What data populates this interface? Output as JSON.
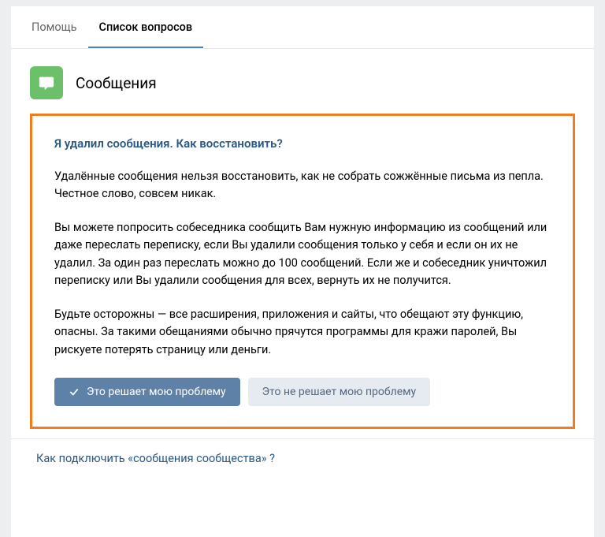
{
  "tabs": {
    "help": "Помощь",
    "questions_list": "Список вопросов"
  },
  "section": {
    "title": "Сообщения"
  },
  "question": {
    "title": "Я удалил сообщения. Как восстановить?",
    "p1": "Удалённые сообщения нельзя восстановить, как не собрать сожжённые письма из пепла. Честное слово, совсем никак.",
    "p2": "Вы можете попросить собеседника сообщить Вам нужную информацию из сообщений или даже переслать переписку, если Вы удалили сообщения только у себя и если он их не удалил. За один раз переслать можно до 100 сообщений. Если же и собеседник уничтожил переписку или Вы удалили сообщения для всех, вернуть их не получится.",
    "p3": "Будьте осторожны — все расширения, приложения и сайты, что обещают эту функцию, опасны. За такими обещаниями обычно прячутся программы для кражи паролей, Вы рискуете потерять страницу или деньги."
  },
  "buttons": {
    "solves": "Это решает мою проблему",
    "not_solves": "Это не решает мою проблему"
  },
  "related": {
    "link1": "Как подключить «сообщения сообщества» ?"
  }
}
